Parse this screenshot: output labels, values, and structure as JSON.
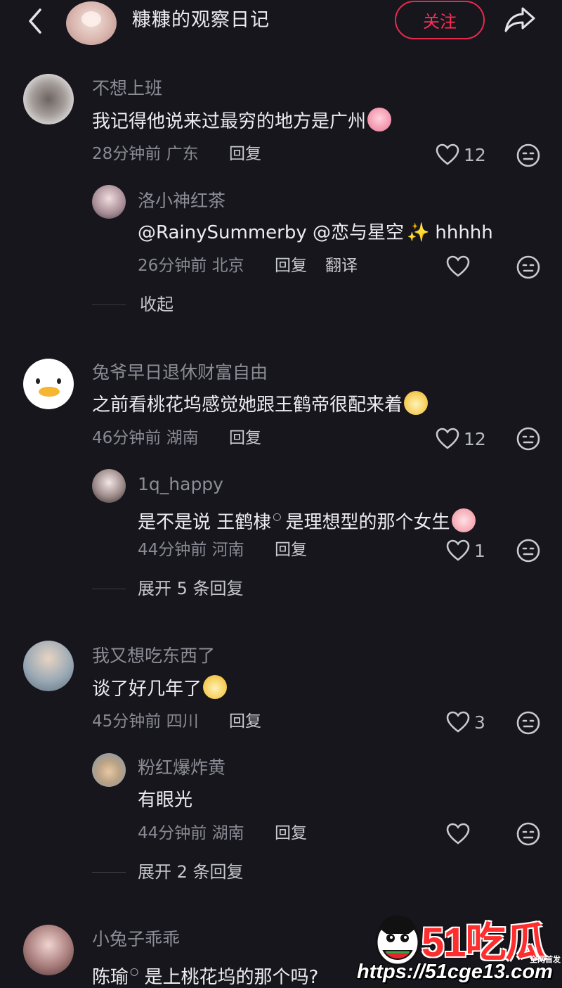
{
  "header": {
    "title": "糠糠的观察日记",
    "follow_label": "关注"
  },
  "comments": [
    {
      "user": "不想上班",
      "text": "我记得他说来过最穷的地方是广州",
      "time": "28分钟前 广东",
      "reply_label": "回复",
      "likes": "12",
      "reply": {
        "user": "洛小神红茶",
        "text": "@RainySummerby @恋与星空",
        "text_tail": "hhhhh",
        "time": "26分钟前 北京",
        "reply_label": "回复",
        "translate_label": "翻译",
        "likes": ""
      },
      "expand_label": "收起"
    },
    {
      "user": "兔爷早日退休财富自由",
      "text": "之前看桃花坞感觉她跟王鹤帝很配来着",
      "time": "46分钟前 湖南",
      "reply_label": "回复",
      "likes": "12",
      "reply": {
        "user": "1q_happy",
        "text_pre": "是不是说 王鹤棣",
        "text_post": "是理想型的那个女生",
        "time": "44分钟前 河南",
        "reply_label": "回复",
        "likes": "1"
      },
      "expand_label": "展开 5 条回复"
    },
    {
      "user": "我又想吃东西了",
      "text": "谈了好几年了",
      "time": "45分钟前 四川",
      "reply_label": "回复",
      "likes": "3",
      "reply": {
        "user": "粉红爆炸黄",
        "text": "有眼光",
        "time": "44分钟前 湖南",
        "reply_label": "回复",
        "likes": ""
      },
      "expand_label": "展开 2 条回复"
    },
    {
      "user": "小兔子乖乖",
      "text_pre": "陈瑜",
      "text_post": " 是上桃花坞的那个吗?"
    }
  ],
  "watermark": {
    "brand": "51吃瓜",
    "tag": "全网首发",
    "url": "https://51cge13.com"
  },
  "colors": {
    "background": "#16161c",
    "accent": "#ff2d55",
    "muted": "#8a8a94"
  },
  "icons": [
    "back-icon",
    "share-icon",
    "heart-icon",
    "dislike-face-icon",
    "search-mark-icon"
  ]
}
